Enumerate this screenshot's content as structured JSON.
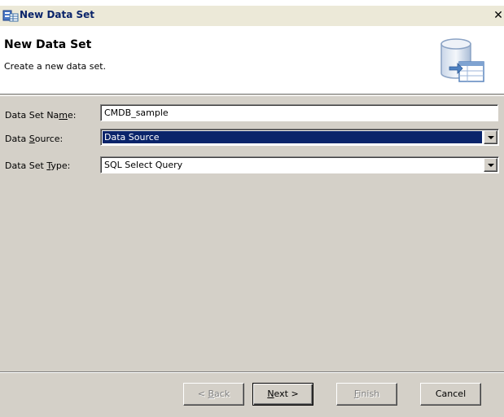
{
  "window": {
    "title": "New Data Set",
    "close_label": "✕",
    "title_icon": "data-set-wizard-icon"
  },
  "banner": {
    "title": "New Data Set",
    "description": "Create a new data set.",
    "icon": "database-table-icon"
  },
  "form": {
    "name": {
      "label_pre": "Data Set Na",
      "label_mnemonic": "m",
      "label_post": "e:",
      "value": "CMDB_sample"
    },
    "source": {
      "label_pre": "Data ",
      "label_mnemonic": "S",
      "label_post": "ource:",
      "value": "Data Source"
    },
    "type": {
      "label_pre": "Data Set ",
      "label_mnemonic": "T",
      "label_post": "ype:",
      "value": "SQL Select Query"
    }
  },
  "buttons": {
    "back": {
      "pre": "< ",
      "mnemonic": "B",
      "post": "ack",
      "enabled": false
    },
    "next": {
      "pre": "",
      "mnemonic": "N",
      "post": "ext >",
      "enabled": true
    },
    "finish": {
      "pre": "",
      "mnemonic": "F",
      "post": "inish",
      "enabled": false
    },
    "cancel": {
      "pre": "Cancel",
      "mnemonic": "",
      "post": "",
      "enabled": true
    }
  },
  "colors": {
    "selection": "#0a246a",
    "dialog_bg": "#d4d0c8",
    "title_text": "#0a246a"
  }
}
